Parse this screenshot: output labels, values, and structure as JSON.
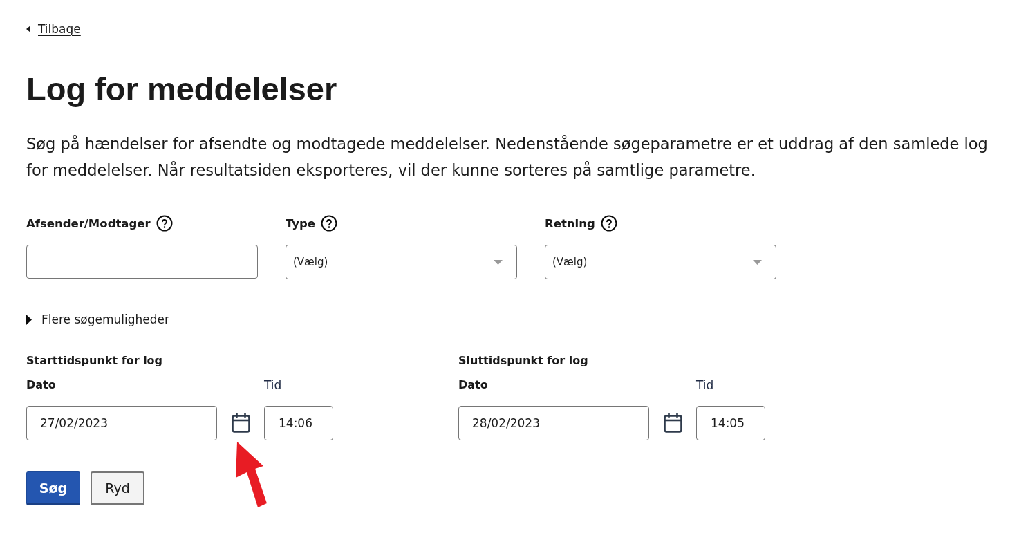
{
  "back_link": {
    "label": "Tilbage"
  },
  "title": "Log for meddelelser",
  "description": "Søg på hændelser for afsendte og modtagede meddelelser. Nedenstående søgeparametre er et uddrag af den samlede log for meddelelser. Når resultatsiden eksporteres, vil der kunne sorteres på samtlige parametre.",
  "filters": [
    {
      "kind": "text",
      "label": "Afsender/Modtager"
    },
    {
      "kind": "select",
      "label": "Type",
      "value": "(Vælg)"
    },
    {
      "kind": "select",
      "label": "Retning",
      "value": "(Vælg)"
    }
  ],
  "more_options": {
    "label": "Flere søgemuligheder",
    "expanded": false
  },
  "time_ranges": [
    {
      "heading": "Starttidspunkt for log",
      "date_label": "Dato",
      "date": "27/02/2023",
      "time_label": "Tid",
      "time": "14:06"
    },
    {
      "heading": "Sluttidspunkt for log",
      "date_label": "Dato",
      "date": "28/02/2023",
      "time_label": "Tid",
      "time": "14:05"
    }
  ],
  "buttons": [
    {
      "kind": "primary",
      "label": "Søg"
    },
    {
      "kind": "secondary",
      "label": "Ryd"
    }
  ],
  "annotations": [
    {
      "kind": "arrow"
    }
  ]
}
